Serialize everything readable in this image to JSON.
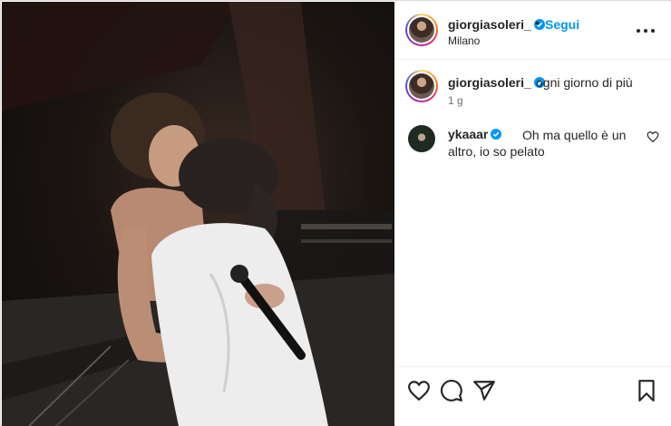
{
  "post": {
    "photo_alt": "",
    "header": {
      "username": "giorgiasoleri_",
      "separator": "•",
      "follow_label": "Segui",
      "location": "Milano"
    },
    "caption": {
      "username": "giorgiasoleri_",
      "text": "ogni giorno di più",
      "time": "1 g"
    },
    "comments": [
      {
        "username": "ykaaar",
        "text": "Oh ma quello è un altro, io so pelato"
      }
    ],
    "icons": {
      "verified": "verified-badge-icon",
      "more": "more-options-icon",
      "like": "heart-icon",
      "comment": "comment-icon",
      "share": "share-icon",
      "save": "bookmark-icon"
    },
    "colors": {
      "follow": "#0095f6",
      "verified": "#0095f6"
    }
  }
}
